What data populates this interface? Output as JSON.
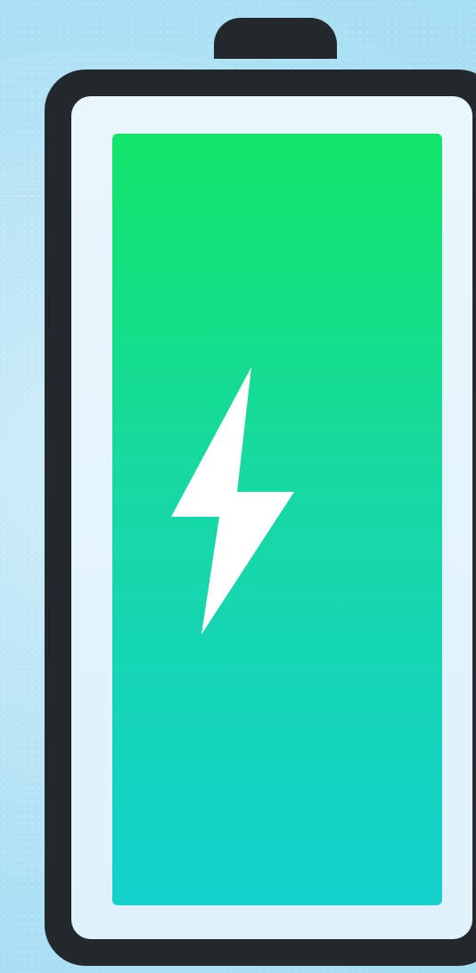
{
  "battery": {
    "charge_level": 1.0,
    "status_icon": "lightning-bolt-icon",
    "colors": {
      "casing": "#23282c",
      "inner_bg": "#e6f4fc",
      "fill_top": "#13e46a",
      "fill_bottom": "#14d1cd",
      "bolt": "#ffffff",
      "background": "#bfe6f6"
    }
  }
}
